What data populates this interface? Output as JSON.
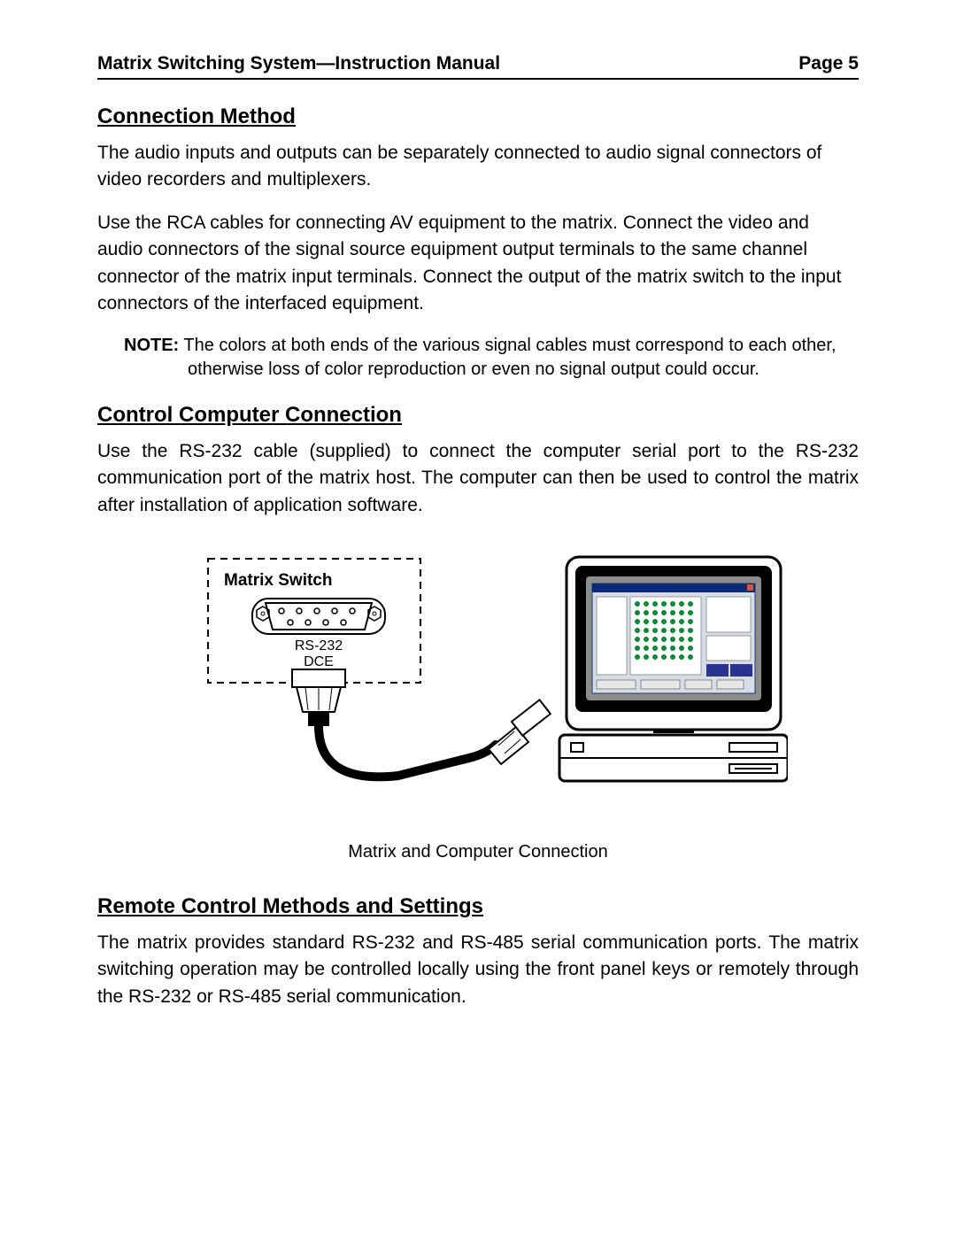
{
  "header": {
    "title": "Matrix Switching System—Instruction Manual",
    "page_label": "Page 5"
  },
  "sections": {
    "connection_method": {
      "heading": "Connection Method",
      "para1": "The audio inputs and outputs can be separately connected to audio signal connectors of video recorders and multiplexers.",
      "para2": "Use the RCA cables for connecting AV equipment to the matrix.  Connect the video and audio connectors of the signal source equipment output terminals to the same channel connector of the matrix input terminals.  Connect the output of the matrix switch to the input connectors of the interfaced equipment.",
      "note_label": "NOTE:",
      "note_text": " The colors at both ends of the various signal cables must correspond to each other, otherwise loss of color reproduction or even no signal output could occur."
    },
    "control_computer": {
      "heading": "Control Computer Connection",
      "para1": "Use the RS-232 cable (supplied) to connect the computer serial port to the RS-232 communication port of the matrix host.  The computer can then be used to control the matrix after installation of application software."
    },
    "figure": {
      "box_title": "Matrix Switch",
      "port_label_1": "RS-232",
      "port_label_2": "DCE",
      "caption": "Matrix and Computer Connection"
    },
    "remote_control": {
      "heading": "Remote Control Methods and Settings",
      "para1": "The matrix provides standard RS-232 and RS-485 serial communication ports.  The matrix switching operation may be controlled locally using the front panel keys or remotely through the RS-232 or RS-485 serial communication."
    }
  }
}
